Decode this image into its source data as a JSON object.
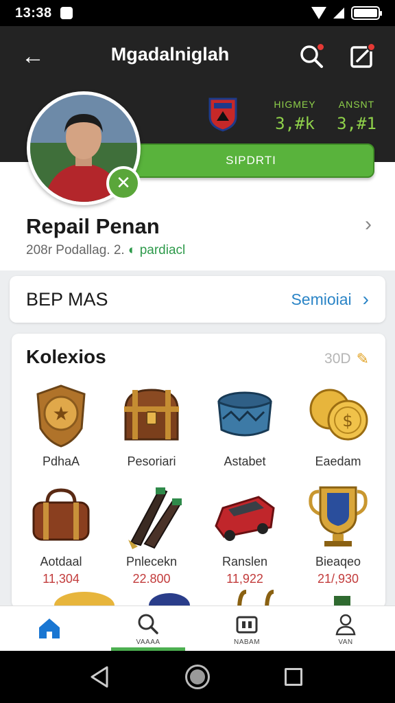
{
  "status_bar": {
    "time": "13:38",
    "icons": [
      "notification-icon",
      "wifi-icon",
      "signal-icon",
      "battery-icon"
    ]
  },
  "header": {
    "title": "Mgadalniglah",
    "icons": [
      "back-arrow-icon",
      "search-icon",
      "edit-icon"
    ],
    "stats": [
      {
        "label": "HIGMEY",
        "value": "3,#k"
      },
      {
        "label": "ANSNT",
        "value": "3,#1"
      }
    ],
    "support_button": "SIPDRTI"
  },
  "profile": {
    "name": "Repail Penan",
    "subtitle": "208r Podallag. 2.",
    "status": "pardiacl"
  },
  "best_card": {
    "title": "BEP MAS",
    "link": "Semioiai"
  },
  "collections": {
    "title": "Kolexios",
    "count": "30D",
    "items": [
      {
        "name": "PdhaA",
        "price": "",
        "icon": "shield-medal-icon"
      },
      {
        "name": "Pesoriari",
        "price": "",
        "icon": "treasure-chest-icon"
      },
      {
        "name": "Astabet",
        "price": "",
        "icon": "drum-icon"
      },
      {
        "name": "Eaedam",
        "price": "",
        "icon": "gold-coins-icon"
      },
      {
        "name": "Aotdaal",
        "price": "11,304",
        "icon": "leather-bag-icon"
      },
      {
        "name": "Pnlecekn",
        "price": "22.800",
        "icon": "rocket-darts-icon"
      },
      {
        "name": "Ranslen",
        "price": "11,922",
        "icon": "red-car-icon"
      },
      {
        "name": "Bieaqeo",
        "price": "21/,930",
        "icon": "trophy-shield-icon"
      }
    ]
  },
  "bottom_nav": [
    {
      "label": "",
      "icon": "home-icon",
      "active": false
    },
    {
      "label": "VAAAA",
      "icon": "search-icon",
      "active": true
    },
    {
      "label": "NABAM",
      "icon": "ticket-icon",
      "active": false
    },
    {
      "label": "VAN",
      "icon": "profile-icon",
      "active": false
    }
  ],
  "colors": {
    "accent_green": "#59b33c",
    "link_blue": "#2a84c6",
    "price_red": "#c23b3b",
    "header_dark": "#232323"
  }
}
